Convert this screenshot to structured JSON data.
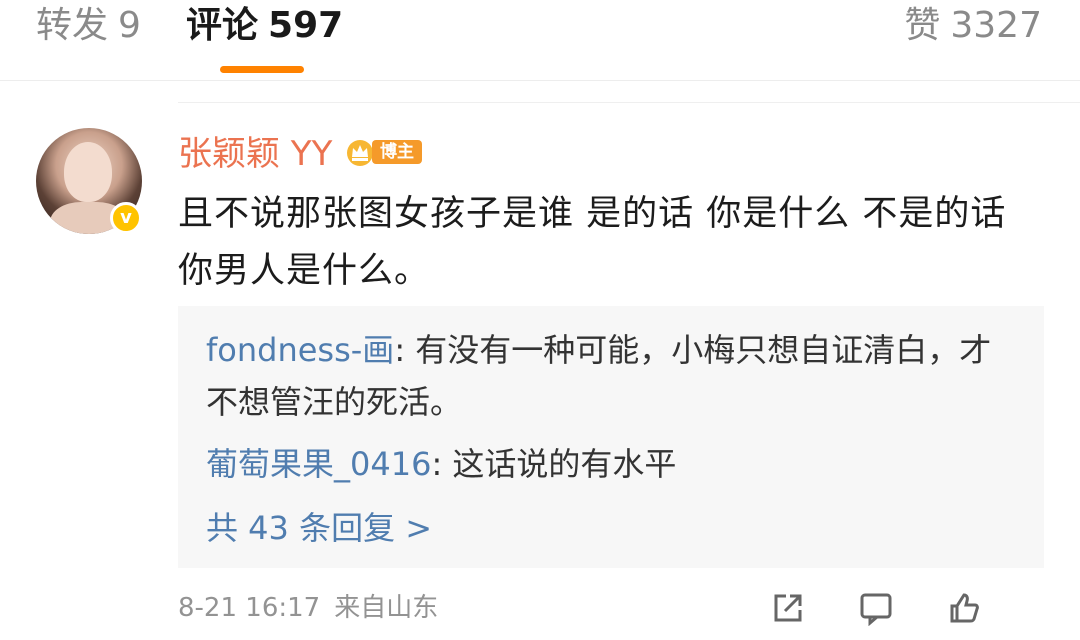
{
  "tabs": {
    "repost": {
      "label": "转发",
      "count": "9"
    },
    "comments": {
      "label": "评论",
      "count": "597"
    },
    "likes": {
      "label": "赞",
      "count": "3327"
    }
  },
  "comment": {
    "username": "张颖颖 YY",
    "badge": "博主",
    "text": "且不说那张图女孩子是谁 是的话 你是什么 不是的话 你男人是什么。",
    "date": "8-21 16:17",
    "location": "来自山东"
  },
  "replies": [
    {
      "user": "fondness-画",
      "text": "有没有一种可能，小梅只想自证清白，才不想管汪的死活。"
    },
    {
      "user": "葡萄果果_0416",
      "text": "这话说的有水平"
    }
  ],
  "more_replies": "共 43 条回复 >",
  "colors": {
    "accent": "#ff8200",
    "username": "#eb7350",
    "link": "#507daf",
    "verified": "#ffc300"
  },
  "icons": [
    "crown-icon",
    "verified-icon",
    "share-icon",
    "comment-icon",
    "like-icon"
  ]
}
